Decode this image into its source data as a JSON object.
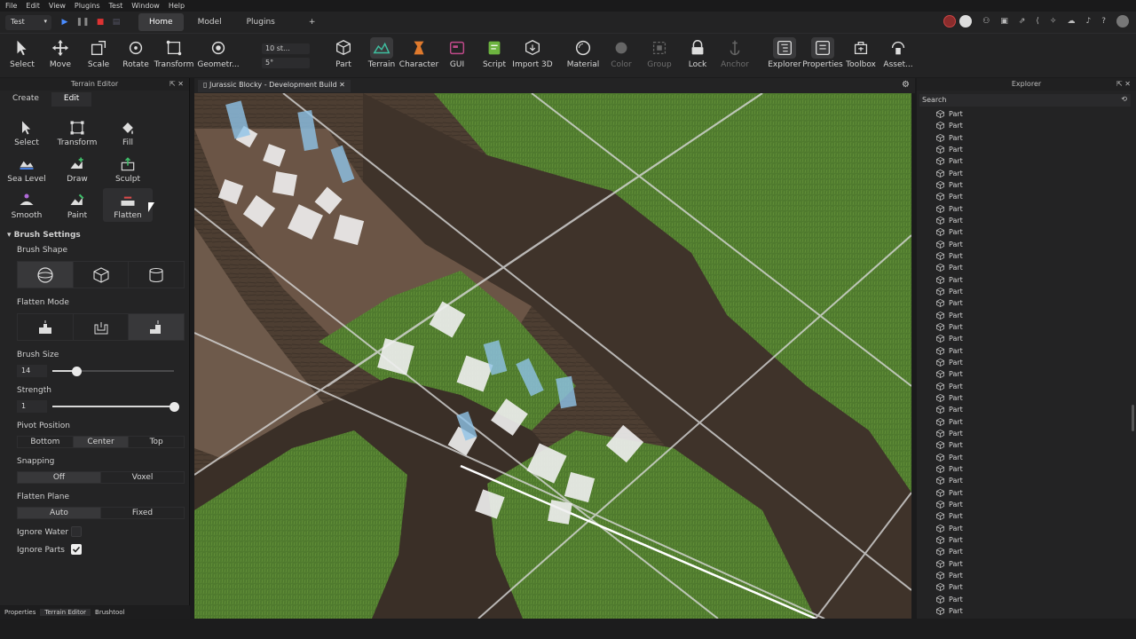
{
  "menu": [
    "File",
    "Edit",
    "View",
    "Plugins",
    "Test",
    "Window",
    "Help"
  ],
  "place_select": "Test",
  "ribbon_tabs": [
    {
      "label": "Home",
      "active": true
    },
    {
      "label": "Model",
      "active": false
    },
    {
      "label": "Plugins",
      "active": false
    }
  ],
  "add_tab": "+",
  "toolbar": {
    "tools": [
      "Select",
      "Move",
      "Scale",
      "Rotate",
      "Transform",
      "Geometr...",
      "Part",
      "Terrain",
      "Character",
      "GUI",
      "Script",
      "Import 3D",
      "Material",
      "Color",
      "Group",
      "Lock",
      "Anchor",
      "Explorer",
      "Properties",
      "Toolbox",
      "Asset..."
    ],
    "move_snap": "10 st...",
    "rotate_snap": "5°"
  },
  "terrain_editor": {
    "title": "Terrain Editor",
    "tabs": [
      {
        "label": "Create",
        "active": false
      },
      {
        "label": "Edit",
        "active": true
      }
    ],
    "tools": [
      "Select",
      "Transform",
      "Fill",
      "Sea Level",
      "Draw",
      "Sculpt",
      "Smooth",
      "Paint",
      "Flatten"
    ],
    "selected_tool": "Flatten",
    "brush_settings_title": "Brush Settings",
    "brush_shape_label": "Brush Shape",
    "brush_shapes": [
      "sphere",
      "cube",
      "cylinder"
    ],
    "flatten_mode_label": "Flatten Mode",
    "brush_size_label": "Brush Size",
    "brush_size_value": "14",
    "brush_size_fraction": 0.2,
    "strength_label": "Strength",
    "strength_value": "1",
    "strength_fraction": 1.0,
    "pivot_label": "Pivot Position",
    "pivot_options": [
      "Bottom",
      "Center",
      "Top"
    ],
    "pivot_selected": "Center",
    "snapping_label": "Snapping",
    "snapping_options": [
      "Off",
      "Voxel"
    ],
    "snapping_selected": "Off",
    "flatten_plane_label": "Flatten Plane",
    "flatten_plane_options": [
      "Auto",
      "Fixed"
    ],
    "flatten_plane_selected": "Auto",
    "ignore_water_label": "Ignore Water",
    "ignore_water": false,
    "ignore_parts_label": "Ignore Parts",
    "ignore_parts": true
  },
  "bottom_tabs": [
    {
      "label": "Properties",
      "active": false
    },
    {
      "label": "Terrain Editor",
      "active": true
    },
    {
      "label": "Brushtool",
      "active": false
    }
  ],
  "document_tab": "Jurassic Blocky - Development Build",
  "explorer": {
    "title": "Explorer",
    "search_placeholder": "Search",
    "items": [
      "Part",
      "Part",
      "Part",
      "Part",
      "Part",
      "Part",
      "Part",
      "Part",
      "Part",
      "Part",
      "Part",
      "Part",
      "Part",
      "Part",
      "Part",
      "Part",
      "Part",
      "Part",
      "Part",
      "Part",
      "Part",
      "Part",
      "Part",
      "Part",
      "Part",
      "Part",
      "Part",
      "Part",
      "Part",
      "Part",
      "Part",
      "Part",
      "Part",
      "Part",
      "Part",
      "Part",
      "Part",
      "Part",
      "Part",
      "Part",
      "Part",
      "Part",
      "Part"
    ]
  },
  "colors": {
    "accent": "#3b82f6",
    "bg": "#232324",
    "panel": "#242425"
  }
}
